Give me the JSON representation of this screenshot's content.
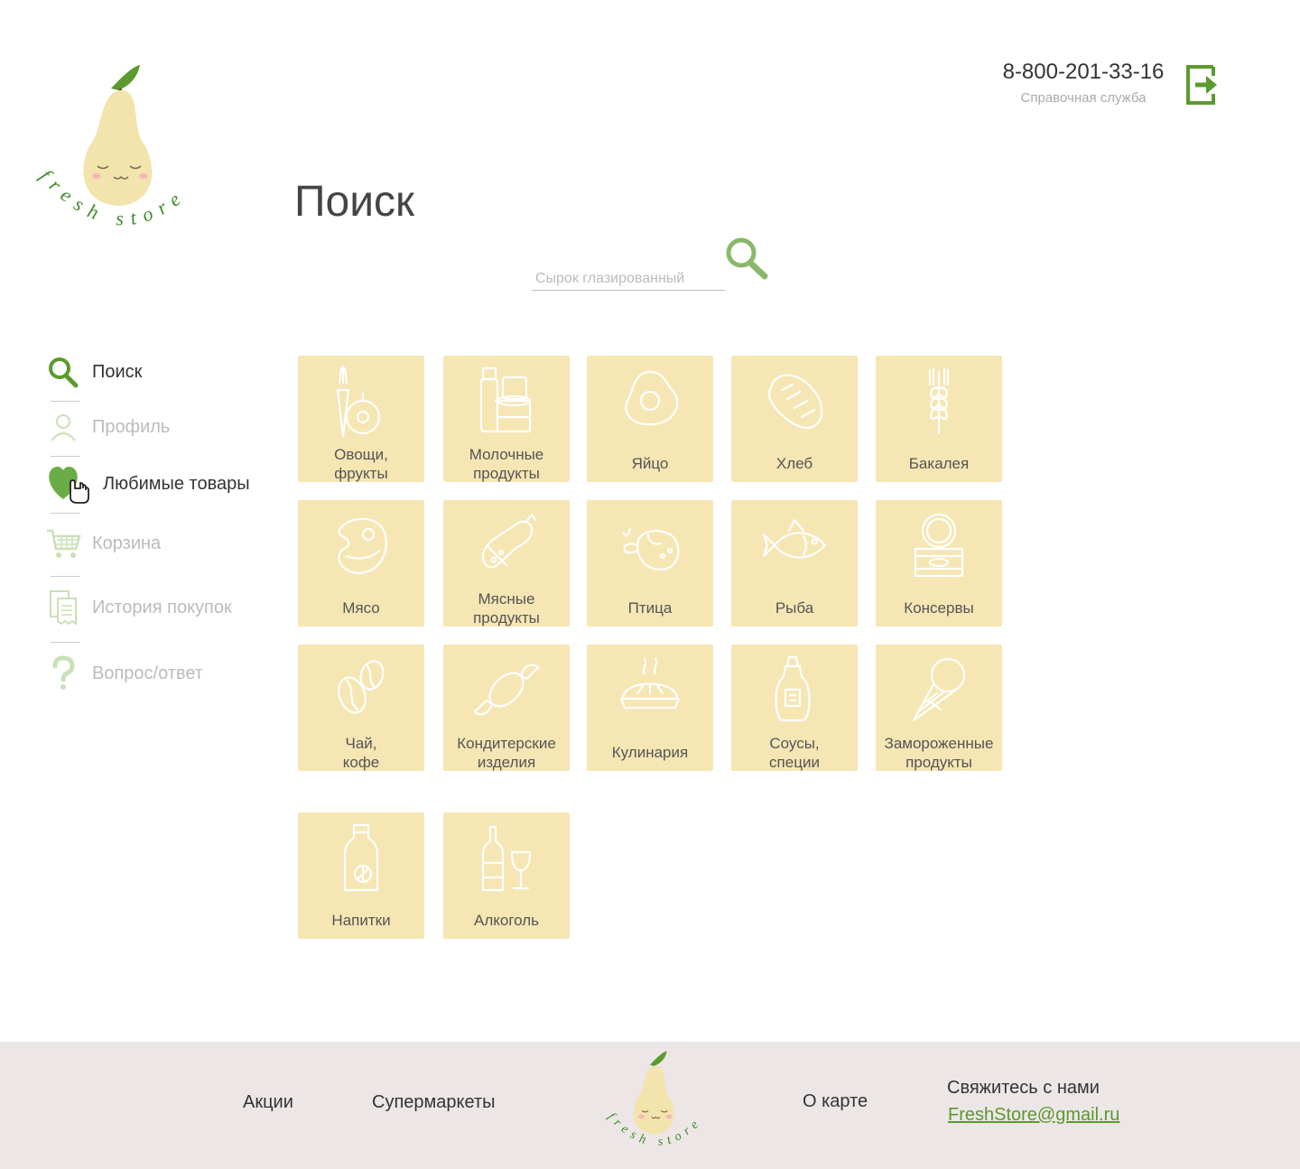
{
  "brand": {
    "logo_text": "fresh store"
  },
  "header": {
    "phone": "8-800-201-33-16",
    "phone_caption": "Справочная служба"
  },
  "main": {
    "title": "Поиск",
    "search": {
      "placeholder": "Сырок глазированный"
    }
  },
  "sidebar": {
    "items": [
      {
        "label": "Поиск",
        "icon": "search-icon",
        "state": "active"
      },
      {
        "label": "Профиль",
        "icon": "user-icon",
        "state": "inactive"
      },
      {
        "label": "Любимые товары",
        "icon": "heart-icon",
        "state": "hover"
      },
      {
        "label": "Корзина",
        "icon": "cart-icon",
        "state": "inactive"
      },
      {
        "label": "История покупок",
        "icon": "receipt-icon",
        "state": "inactive"
      },
      {
        "label": "Вопрос/ответ",
        "icon": "question-icon",
        "state": "inactive"
      }
    ]
  },
  "categories": [
    {
      "label": "Овощи,\nфрукты",
      "icon": "vegetables-icon"
    },
    {
      "label": "Молочные\nпродукты",
      "icon": "dairy-icon"
    },
    {
      "label": "Яйцо",
      "icon": "egg-icon"
    },
    {
      "label": "Хлеб",
      "icon": "bread-icon"
    },
    {
      "label": "Бакалея",
      "icon": "wheat-icon"
    },
    {
      "label": "Мясо",
      "icon": "meat-icon"
    },
    {
      "label": "Мясные\nпродукты",
      "icon": "sausage-icon"
    },
    {
      "label": "Птица",
      "icon": "poultry-icon"
    },
    {
      "label": "Рыба",
      "icon": "fish-icon"
    },
    {
      "label": "Консервы",
      "icon": "canned-icon"
    },
    {
      "label": "Чай,\nкофе",
      "icon": "coffee-beans-icon"
    },
    {
      "label": "Кондитерские\nизделия",
      "icon": "candy-icon"
    },
    {
      "label": "Кулинария",
      "icon": "pie-icon"
    },
    {
      "label": "Соусы,\nспеции",
      "icon": "sauce-bottle-icon"
    },
    {
      "label": "Замороженные\nпродукты",
      "icon": "ice-cream-icon"
    },
    {
      "label": "Напитки",
      "icon": "drink-bottle-icon"
    },
    {
      "label": "Алкоголь",
      "icon": "wine-icon"
    }
  ],
  "footer": {
    "promos": "Акции",
    "supermarkets": "Супермаркеты",
    "about_card": "О карте",
    "contact_title": "Свяжитесь с нами",
    "email": "FreshStore@gmail.ru"
  },
  "colors": {
    "accent_green": "#5a9a2f",
    "tile_bg": "#f5e6b4",
    "footer_bg": "#ede6e6",
    "pear": "#f3e4ad"
  }
}
